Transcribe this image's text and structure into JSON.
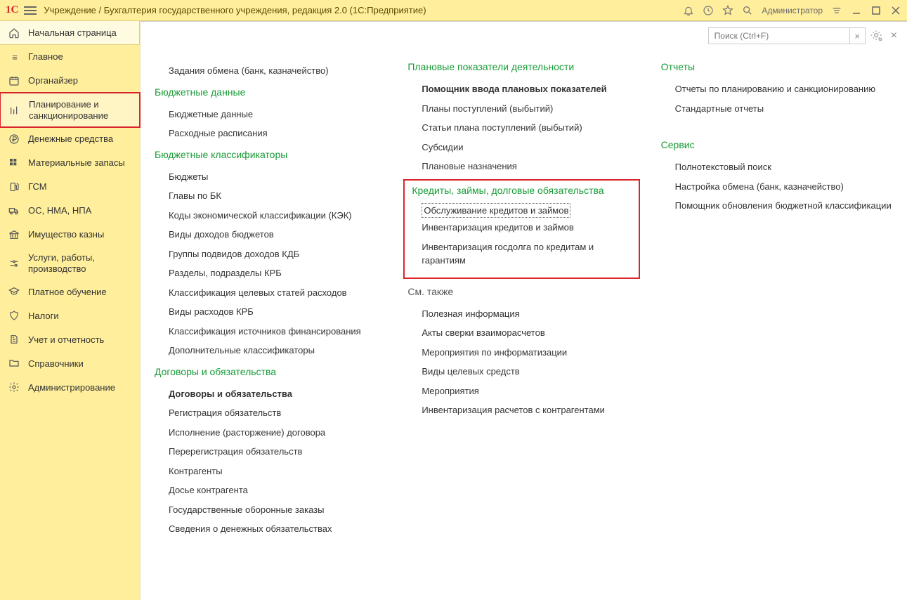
{
  "titlebar": {
    "title": "Учреждение / Бухгалтерия государственного учреждения, редакция 2.0  (1С:Предприятие)",
    "user": "Администратор"
  },
  "sidebar": {
    "home": "Начальная страница",
    "items": [
      "Главное",
      "Органайзер",
      "Планирование и санкционирование",
      "Денежные средства",
      "Материальные запасы",
      "ГСМ",
      "ОС, НМА, НПА",
      "Имущество казны",
      "Услуги, работы, производство",
      "Платное обучение",
      "Налоги",
      "Учет и отчетность",
      "Справочники",
      "Администрирование"
    ]
  },
  "search": {
    "placeholder": "Поиск (Ctrl+F)"
  },
  "col1": {
    "top_link": "Задания обмена (банк, казначейство)",
    "g1_title": "Бюджетные данные",
    "g1_items": [
      "Бюджетные данные",
      "Расходные расписания"
    ],
    "g2_title": "Бюджетные классификаторы",
    "g2_items": [
      "Бюджеты",
      "Главы по БК",
      "Коды экономической классификации (КЭК)",
      "Виды доходов бюджетов",
      "Группы подвидов доходов КДБ",
      "Разделы, подразделы КРБ",
      "Классификация целевых статей расходов",
      "Виды расходов КРБ",
      "Классификация источников финансирования",
      "Дополнительные классификаторы"
    ],
    "g3_title": "Договоры и обязательства",
    "g3_items": [
      "Договоры и обязательства",
      "Регистрация обязательств",
      "Исполнение (расторжение) договора",
      "Перерегистрация обязательств",
      "Контрагенты",
      "Досье контрагента",
      "Государственные оборонные заказы",
      "Сведения о денежных обязательствах"
    ]
  },
  "col2": {
    "g1_title": "Плановые показатели деятельности",
    "g1_items": [
      "Помощник ввода плановых показателей",
      "Планы поступлений (выбытий)",
      "Статьи плана поступлений (выбытий)",
      "Субсидии",
      "Плановые назначения"
    ],
    "g2_title": "Кредиты, займы, долговые обязательства",
    "g2_items": [
      "Обслуживание кредитов и займов",
      "Инвентаризация кредитов и займов",
      "Инвентаризация госдолга по кредитам и гарантиям"
    ],
    "g3_title": "См. также",
    "g3_items": [
      "Полезная информация",
      "Акты сверки взаиморасчетов",
      "Мероприятия по информатизации",
      "Виды целевых средств",
      "Мероприятия",
      "Инвентаризация расчетов с контрагентами"
    ]
  },
  "col3": {
    "g1_title": "Отчеты",
    "g1_items": [
      "Отчеты по планированию и санкционированию",
      "Стандартные отчеты"
    ],
    "g2_title": "Сервис",
    "g2_items": [
      "Полнотекстовый поиск",
      "Настройка обмена (банк, казначейство)",
      "Помощник обновления бюджетной классификации"
    ]
  }
}
